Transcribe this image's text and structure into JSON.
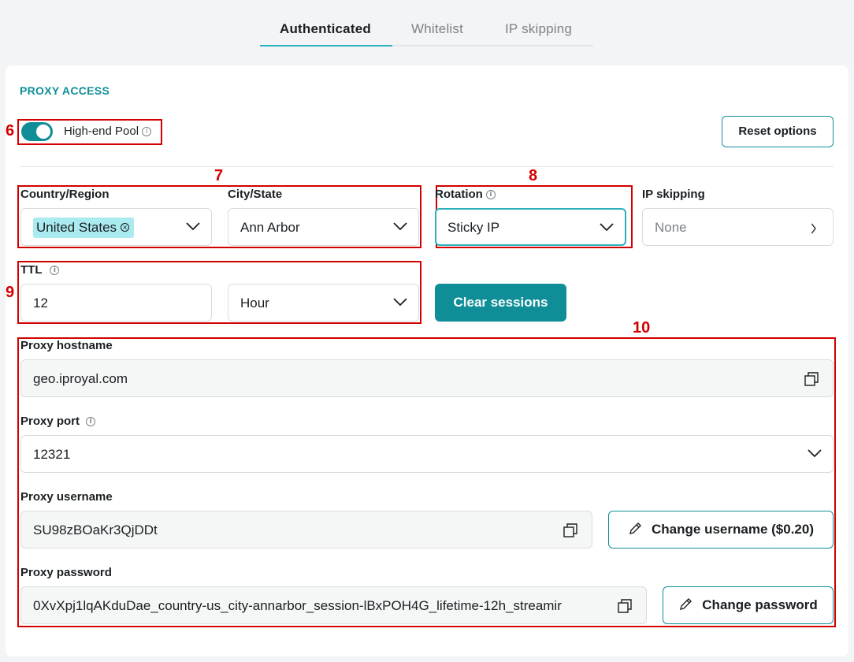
{
  "tabs": [
    {
      "label": "Authenticated",
      "active": true
    },
    {
      "label": "Whitelist",
      "active": false
    },
    {
      "label": "IP skipping",
      "active": false
    }
  ],
  "section_title": "PROXY ACCESS",
  "annotations": {
    "a6": "6",
    "a7": "7",
    "a8": "8",
    "a9": "9",
    "a10": "10"
  },
  "high_end_pool": {
    "label": "High-end Pool",
    "enabled": true
  },
  "reset_button": "Reset options",
  "country": {
    "label": "Country/Region",
    "value": "United States"
  },
  "city": {
    "label": "City/State",
    "value": "Ann Arbor"
  },
  "rotation": {
    "label": "Rotation",
    "value": "Sticky IP"
  },
  "ip_skipping": {
    "label": "IP skipping",
    "value": "None"
  },
  "ttl": {
    "label": "TTL",
    "value": "12",
    "unit": "Hour"
  },
  "clear_sessions": "Clear sessions",
  "hostname": {
    "label": "Proxy hostname",
    "value": "geo.iproyal.com"
  },
  "port": {
    "label": "Proxy port",
    "value": "12321"
  },
  "username": {
    "label": "Proxy username",
    "value": "SU98zBOaKr3QjDDt",
    "change_label": "Change username ($0.20)"
  },
  "password": {
    "label": "Proxy password",
    "value": "0XvXpj1lqAKduDae_country-us_city-annarbor_session-lBxPOH4G_lifetime-12h_streamir",
    "change_label": "Change password"
  },
  "colors": {
    "accent": "#0f8e98",
    "annotation": "#d40000",
    "chip": "#a9ebef"
  }
}
